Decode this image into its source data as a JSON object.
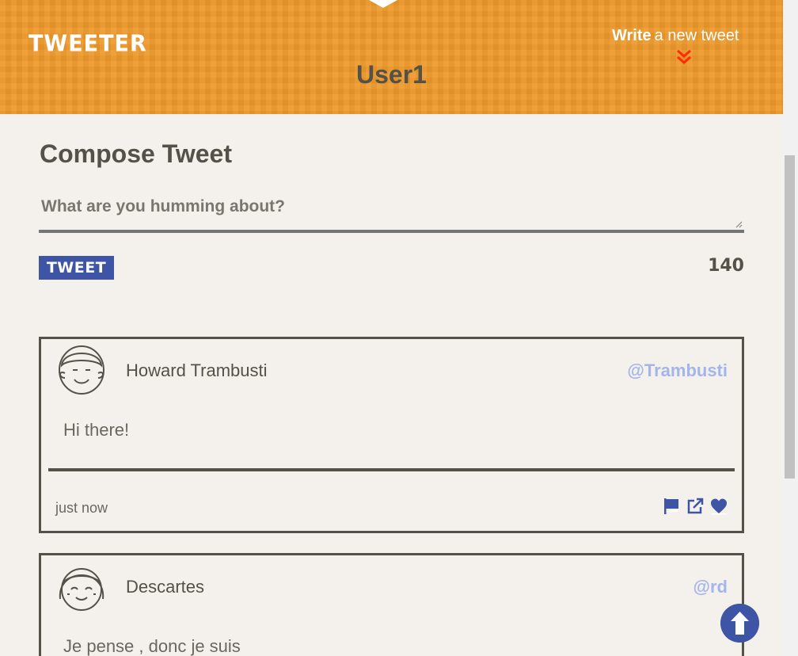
{
  "nav": {
    "logo": "TWEETER",
    "write_bold": "Write",
    "write_rest": "a new tweet",
    "chevron_icon": "double-chevron-down-icon",
    "chevron_color": "#ff2a00"
  },
  "profile": {
    "username": "User1"
  },
  "compose": {
    "title": "Compose Tweet",
    "placeholder": "What are you humming about?",
    "button_label": "TWEET",
    "counter": "140"
  },
  "tweets": [
    {
      "name": "Howard Trambusti",
      "handle": "@Trambusti",
      "content": "Hi there!",
      "time": "just now",
      "avatar_icon": "boy-avatar-icon",
      "actions": [
        "flag-icon",
        "share-icon",
        "heart-icon"
      ]
    },
    {
      "name": "Descartes",
      "handle": "@rd",
      "content": "Je pense , donc je suis",
      "avatar_icon": "girl-avatar-icon"
    }
  ],
  "colors": {
    "header": "#ee9a2b",
    "accent": "#3e54a4",
    "text": "#545149",
    "handle": "#a3b5ea",
    "background": "#f4f1ec"
  },
  "scroll_top_icon": "arrow-up-circle-icon"
}
